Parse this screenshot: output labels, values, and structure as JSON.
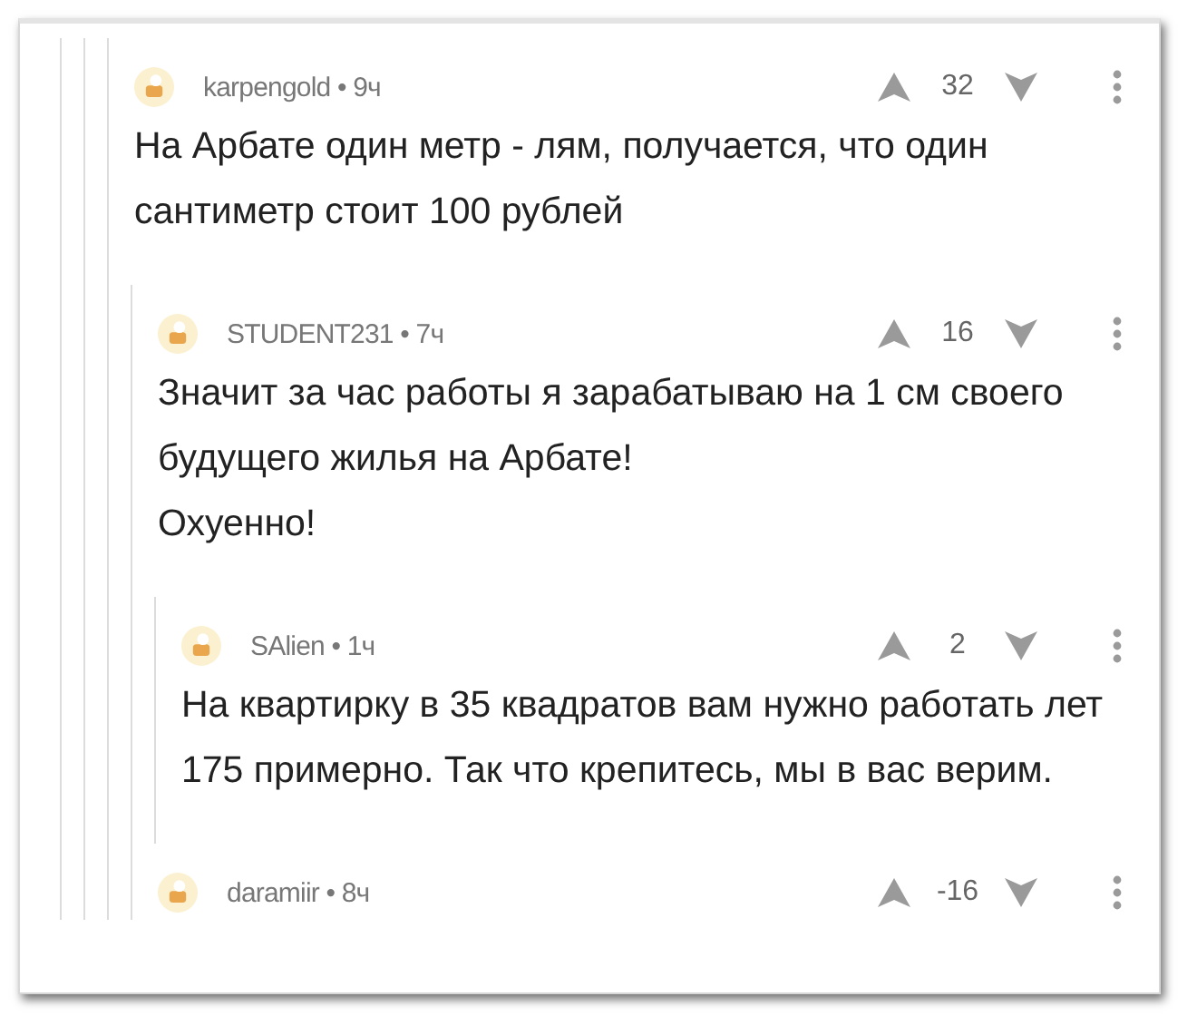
{
  "comments": [
    {
      "meta": "karpengold • 9ч",
      "score": "32",
      "paragraphs": [
        "На Арбате один метр - лям, получается, что один сантиметр стоит 100 рублей"
      ],
      "children": [
        {
          "meta": "STUDENT231 • 7ч",
          "score": "16",
          "paragraphs": [
            "Значит за час работы я зарабатываю на 1 см своего будущего жилья на Арбате!",
            "Охуенно!"
          ],
          "children": [
            {
              "meta": "SAlien • 1ч",
              "score": "2",
              "paragraphs": [
                "На квартирку в 35 квадратов вам нужно работать лет 175 примерно. Так что крепитесь, мы в вас верим."
              ]
            }
          ]
        },
        {
          "meta": "daramiir • 8ч",
          "score": "-16"
        }
      ]
    }
  ]
}
